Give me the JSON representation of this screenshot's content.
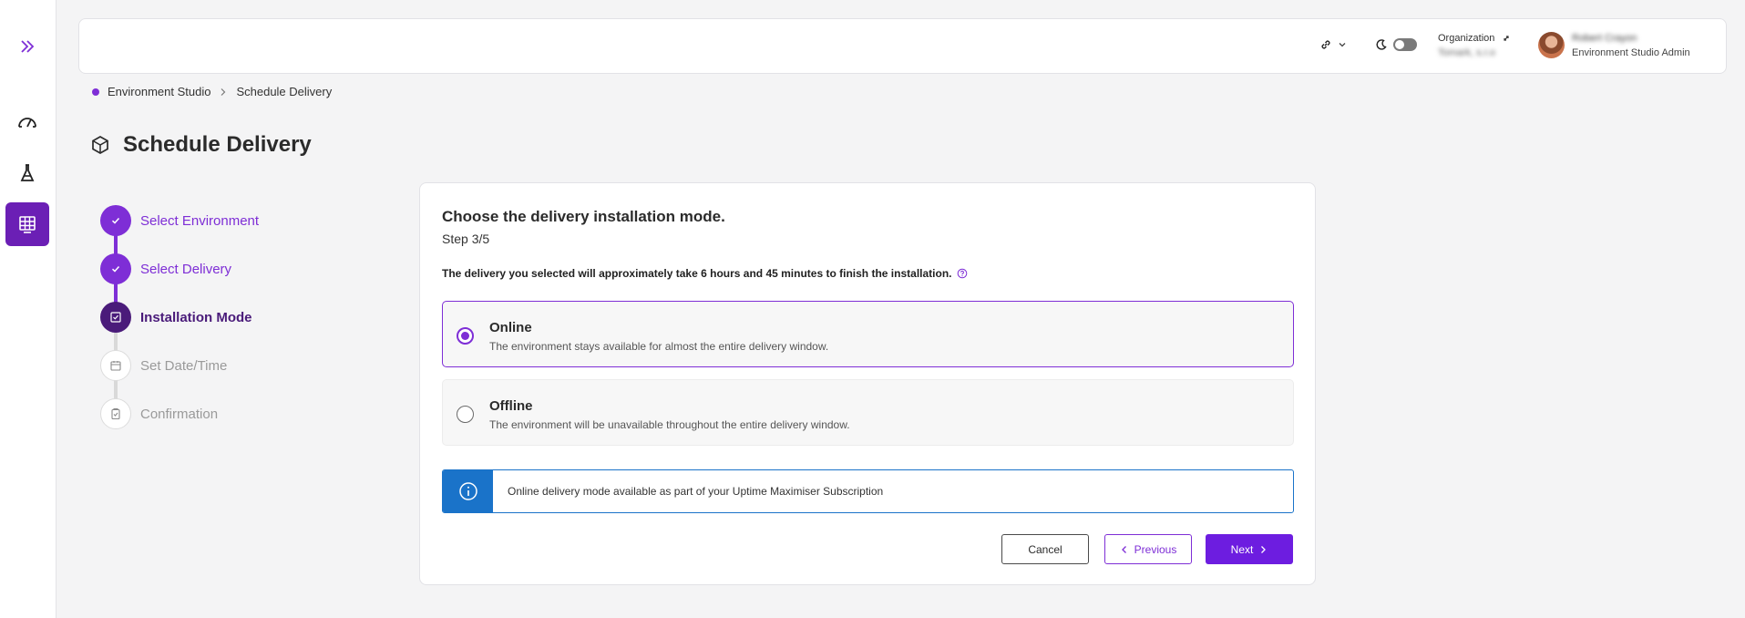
{
  "header": {
    "organization_label": "Organization",
    "organization_value": "Tomark, s.r.o",
    "user_name": "Robert Crayon",
    "user_role": "Environment Studio Admin"
  },
  "breadcrumb": {
    "root": "Environment Studio",
    "current": "Schedule Delivery"
  },
  "page": {
    "title": "Schedule Delivery"
  },
  "stepper": {
    "steps": [
      {
        "label": "Select Environment",
        "state": "done"
      },
      {
        "label": "Select Delivery",
        "state": "done"
      },
      {
        "label": "Installation Mode",
        "state": "current"
      },
      {
        "label": "Set Date/Time",
        "state": "todo"
      },
      {
        "label": "Confirmation",
        "state": "todo"
      }
    ]
  },
  "card": {
    "title": "Choose the delivery installation mode.",
    "step": "Step 3/5",
    "info": "The delivery you selected will approximately take 6 hours and 45 minutes to finish the installation.",
    "options": [
      {
        "title": "Online",
        "description": "The environment stays available for almost the entire delivery window.",
        "selected": true
      },
      {
        "title": "Offline",
        "description": "The environment will be unavailable throughout the entire delivery window.",
        "selected": false
      }
    ],
    "notice": "Online delivery mode available as part of your Uptime Maximiser Subscription"
  },
  "actions": {
    "cancel": "Cancel",
    "previous": "Previous",
    "next": "Next"
  },
  "colors": {
    "accent": "#7e2ed6",
    "accent_dark": "#4a1b7a",
    "info_blue": "#1a73c9",
    "sidebar_active": "#6b1fb5"
  }
}
